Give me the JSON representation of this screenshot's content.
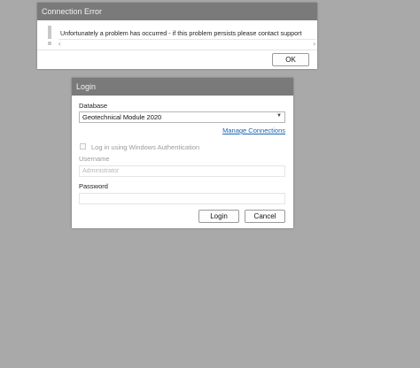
{
  "connection_error": {
    "title": "Connection Error",
    "message": "Unfortunately a problem has occurred - if this problem persists please contact support",
    "ok_label": "OK",
    "icon": "warning-exclamation-icon"
  },
  "login": {
    "title": "Login",
    "database_label": "Database",
    "database_value": "Geotechnical Module 2020",
    "manage_connections_label": "Manage Connections",
    "windows_auth_label": "Log in using Windows Authentication",
    "windows_auth_checked": false,
    "username_label": "Username",
    "username_placeholder": "Administrator",
    "password_label": "Password",
    "login_label": "Login",
    "cancel_label": "Cancel"
  }
}
